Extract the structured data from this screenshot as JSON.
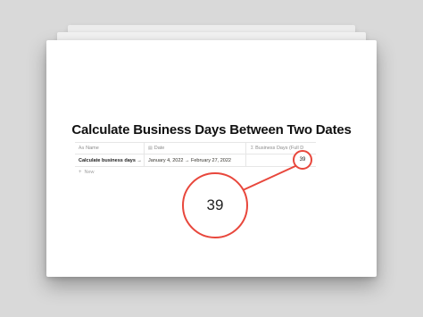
{
  "page": {
    "title": "Calculate Business Days Between Two Dates"
  },
  "table": {
    "columns": [
      {
        "icon": "text-icon",
        "label": "Name"
      },
      {
        "icon": "calendar-icon",
        "label": "Date"
      },
      {
        "icon": "formula-icon",
        "label": "Business Days (Full D"
      }
    ],
    "rows": [
      {
        "name": "Calculate business days →",
        "date": "January 4, 2022 → February 27, 2022",
        "business_days": "39"
      }
    ],
    "new_label": "New"
  },
  "callout": {
    "value": "39",
    "accent_color": "#e8473c"
  }
}
